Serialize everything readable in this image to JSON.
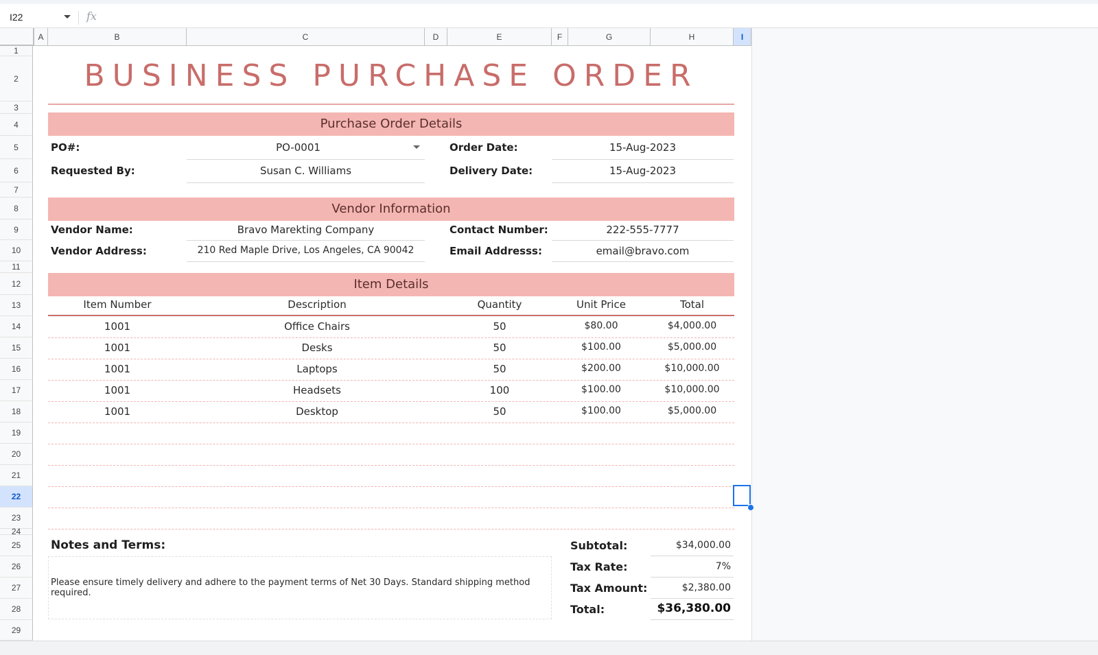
{
  "formula_bar": {
    "cell_ref": "I22",
    "fx_symbol": "fx"
  },
  "columns": [
    "A",
    "B",
    "C",
    "D",
    "E",
    "F",
    "G",
    "H",
    "I"
  ],
  "rows": [
    "1",
    "2",
    "3",
    "4",
    "5",
    "6",
    "7",
    "8",
    "9",
    "10",
    "11",
    "12",
    "13",
    "14",
    "15",
    "16",
    "17",
    "18",
    "19",
    "20",
    "21",
    "22",
    "23",
    "24",
    "25",
    "26",
    "27",
    "28",
    "29"
  ],
  "selected_column": "I",
  "selected_row": "22",
  "title": "BUSINESS PURCHASE ORDER",
  "po_details": {
    "header": "Purchase Order Details",
    "po_label": "PO#:",
    "po_value": "PO-0001",
    "requested_label": "Requested By:",
    "requested_value": "Susan C. Williams",
    "order_date_label": "Order Date:",
    "order_date_value": "15-Aug-2023",
    "delivery_date_label": "Delivery Date:",
    "delivery_date_value": "15-Aug-2023"
  },
  "vendor": {
    "header": "Vendor Information",
    "name_label": "Vendor Name:",
    "name_value": "Bravo Marekting Company",
    "address_label": "Vendor Address:",
    "address_value": "210 Red Maple Drive, Los Angeles, CA 90042",
    "contact_label": "Contact Number:",
    "contact_value": "222-555-7777",
    "email_label": "Email Addresss:",
    "email_value": "email@bravo.com"
  },
  "items": {
    "header": "Item Details",
    "columns": [
      "Item Number",
      "Description",
      "Quantity",
      "Unit Price",
      "Total"
    ],
    "rows": [
      [
        "1001",
        "Office Chairs",
        "50",
        "$80.00",
        "$4,000.00"
      ],
      [
        "1001",
        "Desks",
        "50",
        "$100.00",
        "$5,000.00"
      ],
      [
        "1001",
        "Laptops",
        "50",
        "$200.00",
        "$10,000.00"
      ],
      [
        "1001",
        "Headsets",
        "100",
        "$100.00",
        "$10,000.00"
      ],
      [
        "1001",
        "Desktop",
        "50",
        "$100.00",
        "$5,000.00"
      ]
    ]
  },
  "notes": {
    "label": "Notes and Terms:",
    "text": "Please ensure timely delivery and adhere to the payment terms of Net 30 Days. Standard shipping method required."
  },
  "summary": {
    "subtotal_label": "Subtotal:",
    "subtotal_value": "$34,000.00",
    "tax_rate_label": "Tax Rate:",
    "tax_rate_value": "7%",
    "tax_amount_label": "Tax Amount:",
    "tax_amount_value": "$2,380.00",
    "total_label": "Total:",
    "total_value": "$36,380.00"
  },
  "colors": {
    "accent": "#c86d6a",
    "band": "#f4b6b2",
    "selection": "#1a73e8"
  }
}
